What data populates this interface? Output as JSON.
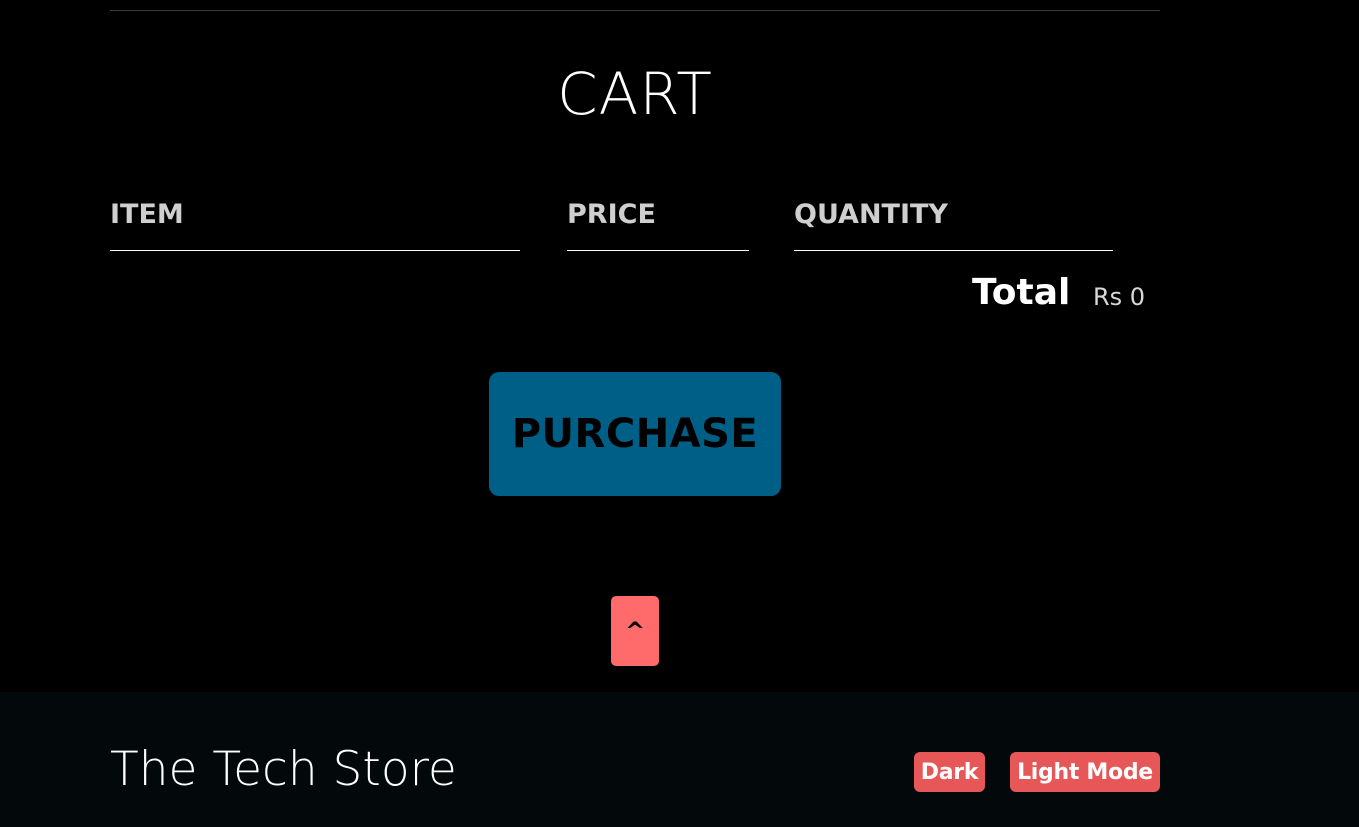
{
  "cart": {
    "title": "CART",
    "columns": {
      "item": "ITEM",
      "price": "PRICE",
      "quantity": "QUANTITY"
    },
    "items": [],
    "total_label": "Total",
    "total_value": "Rs 0",
    "purchase_label": "PURCHASE"
  },
  "scroll_top": {
    "label": "^"
  },
  "footer": {
    "store_name": "The Tech Store",
    "dark_label": "Dark",
    "light_label": "Light Mode"
  },
  "colors": {
    "background": "#000000",
    "purchase_button": "#005f87",
    "scroll_top_button": "#ff6b6b",
    "theme_buttons": "#e85757",
    "footer_background": "#03080a"
  }
}
